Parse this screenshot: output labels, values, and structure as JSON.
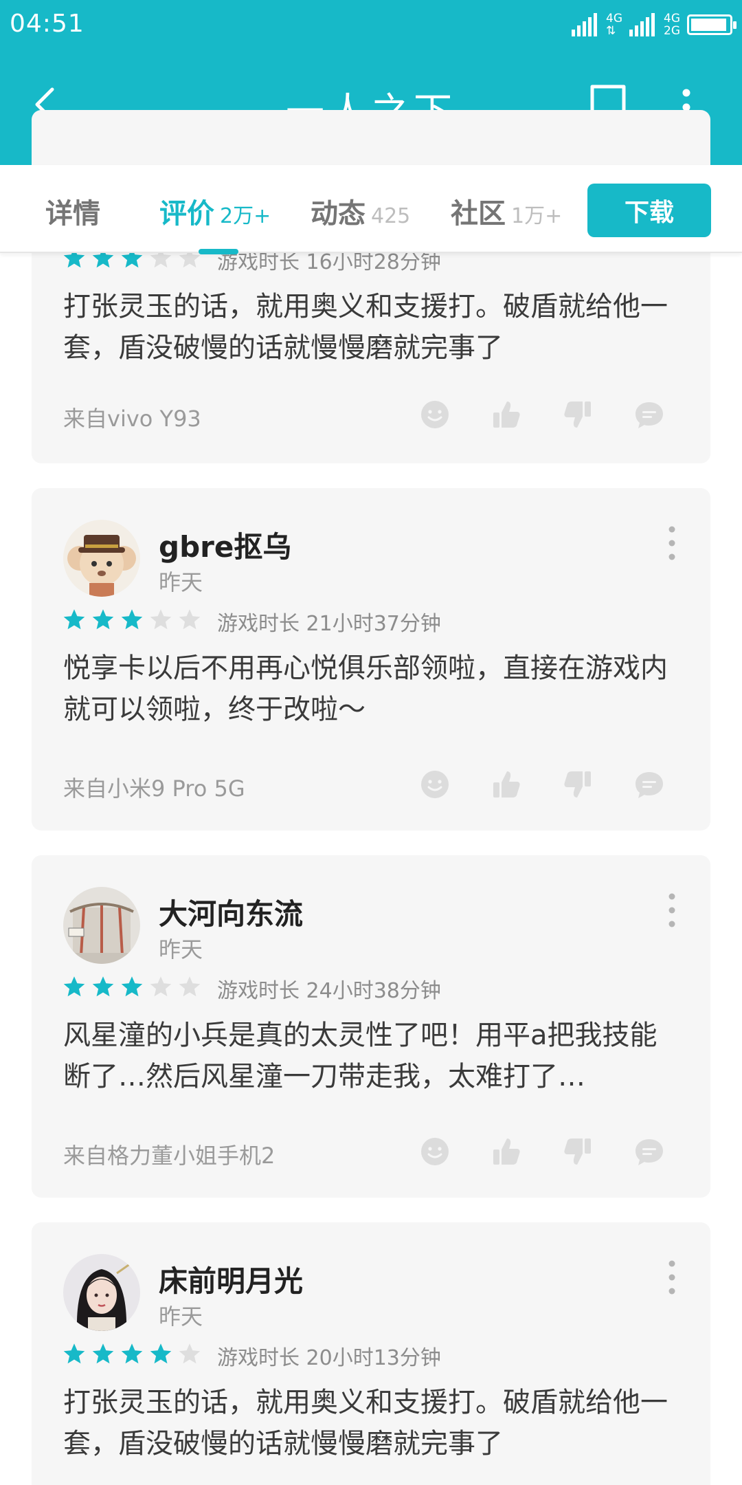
{
  "status_bar": {
    "time": "04:51",
    "net1": "4G",
    "net2_top": "4G",
    "net2_bottom": "2G",
    "battery_level_percent": 95
  },
  "app_bar": {
    "title": "一人之下",
    "icons": [
      "back-arrow-icon",
      "bookmark-icon",
      "more-vertical-icon"
    ]
  },
  "tabs": [
    {
      "label": "详情",
      "count": ""
    },
    {
      "label": "评价",
      "count": "2万+",
      "active": true
    },
    {
      "label": "动态",
      "count": "425"
    },
    {
      "label": "社区",
      "count": "1万+"
    }
  ],
  "download_label": "下载",
  "reviews": [
    {
      "username": "",
      "date": "",
      "rating": 3,
      "playtime": "游戏时长 16小时28分钟",
      "text": "打张灵玉的话，就用奥义和支援打。破盾就给他一套，盾没破慢的话就慢慢磨就完事了",
      "device": "来自vivo Y93"
    },
    {
      "username": "gbre抠乌",
      "date": "昨天",
      "rating": 3,
      "playtime": "游戏时长 21小时37分钟",
      "text": "悦享卡以后不用再心悦俱乐部领啦，直接在游戏内就可以领啦，终于改啦～",
      "device": "来自小米9 Pro 5G"
    },
    {
      "username": "大河向东流",
      "date": "昨天",
      "rating": 3,
      "playtime": "游戏时长 24小时38分钟",
      "text": "风星潼的小兵是真的太灵性了吧！用平a把我技能断了…然后风星潼一刀带走我，太难打了…",
      "device": "来自格力董小姐手机2"
    },
    {
      "username": "床前明月光",
      "date": "昨天",
      "rating": 4,
      "playtime": "游戏时长 20小时13分钟",
      "text": "打张灵玉的话，就用奥义和支援打。破盾就给他一套，盾没破慢的话就慢慢磨就完事了",
      "device": ""
    }
  ],
  "colors": {
    "accent": "#17b9c8",
    "star_on": "#17b9c8",
    "star_off": "#dedede",
    "card_bg": "#f6f6f6"
  }
}
